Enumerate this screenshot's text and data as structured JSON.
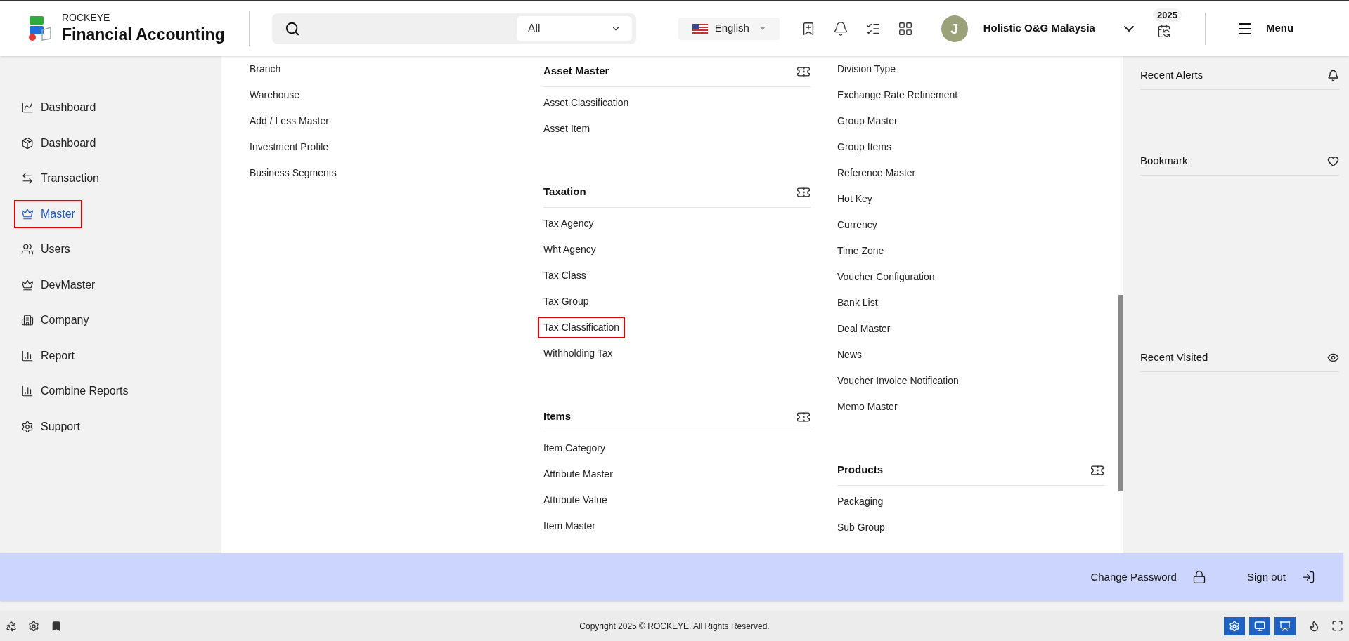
{
  "header": {
    "brand_top": "ROCKEYE",
    "brand_name": "Financial Accounting",
    "search": {
      "scope": "All"
    },
    "language": "English",
    "user": {
      "initial": "J",
      "company": "Holistic O&G Malaysia"
    },
    "year_badge": "2025",
    "menu_label": "Menu"
  },
  "sidebar": {
    "items": [
      {
        "label": "Dashboard",
        "selected": false
      },
      {
        "label": "Dashboard",
        "selected": false
      },
      {
        "label": "Transaction",
        "selected": false
      },
      {
        "label": "Master",
        "selected": true
      },
      {
        "label": "Users",
        "selected": false
      },
      {
        "label": "DevMaster",
        "selected": false
      },
      {
        "label": "Company",
        "selected": false
      },
      {
        "label": "Report",
        "selected": false
      },
      {
        "label": "Combine Reports",
        "selected": false
      },
      {
        "label": "Support",
        "selected": false
      }
    ]
  },
  "menu_columns": [
    {
      "sections": [
        {
          "items": [
            {
              "label": "Branch",
              "highlighted": false
            },
            {
              "label": "Warehouse",
              "highlighted": false
            },
            {
              "label": "Add / Less Master",
              "highlighted": false
            },
            {
              "label": "Investment Profile",
              "highlighted": false
            },
            {
              "label": "Business Segments",
              "highlighted": false
            }
          ]
        }
      ]
    },
    {
      "sections": [
        {
          "title": "Asset Master",
          "items": [
            {
              "label": "Asset Classification",
              "highlighted": false
            },
            {
              "label": "Asset Item",
              "highlighted": false
            }
          ]
        },
        {
          "title": "Taxation",
          "items": [
            {
              "label": "Tax Agency",
              "highlighted": false
            },
            {
              "label": "Wht Agency",
              "highlighted": false
            },
            {
              "label": "Tax Class",
              "highlighted": false
            },
            {
              "label": "Tax Group",
              "highlighted": false
            },
            {
              "label": "Tax Classification",
              "highlighted": true
            },
            {
              "label": "Withholding Tax",
              "highlighted": false
            }
          ]
        },
        {
          "title": "Items",
          "items": [
            {
              "label": "Item Category",
              "highlighted": false
            },
            {
              "label": "Attribute Master",
              "highlighted": false
            },
            {
              "label": "Attribute Value",
              "highlighted": false
            },
            {
              "label": "Item Master",
              "highlighted": false
            }
          ]
        }
      ]
    },
    {
      "sections": [
        {
          "items": [
            {
              "label": "Division Type",
              "highlighted": false
            },
            {
              "label": "Exchange Rate Refinement",
              "highlighted": false
            },
            {
              "label": "Group Master",
              "highlighted": false
            },
            {
              "label": "Group Items",
              "highlighted": false
            },
            {
              "label": "Reference Master",
              "highlighted": false
            },
            {
              "label": "Hot Key",
              "highlighted": false
            },
            {
              "label": "Currency",
              "highlighted": false
            },
            {
              "label": "Time Zone",
              "highlighted": false
            },
            {
              "label": "Voucher Configuration",
              "highlighted": false
            },
            {
              "label": "Bank List",
              "highlighted": false
            },
            {
              "label": "Deal Master",
              "highlighted": false
            },
            {
              "label": "News",
              "highlighted": false
            },
            {
              "label": "Voucher Invoice Notification",
              "highlighted": false
            },
            {
              "label": "Memo Master",
              "highlighted": false
            }
          ]
        },
        {
          "title": "Products",
          "items": [
            {
              "label": "Packaging",
              "highlighted": false
            },
            {
              "label": "Sub Group",
              "highlighted": false
            }
          ]
        }
      ]
    }
  ],
  "right_panel": [
    {
      "title": "Recent Alerts"
    },
    {
      "title": "Bookmark"
    },
    {
      "title": "Recent Visited"
    }
  ],
  "footer": {
    "change_password": "Change Password",
    "sign_out": "Sign out"
  },
  "status_bar": {
    "copyright": "Copyright 2025 © ROCKEYE. All Rights Reserved."
  }
}
